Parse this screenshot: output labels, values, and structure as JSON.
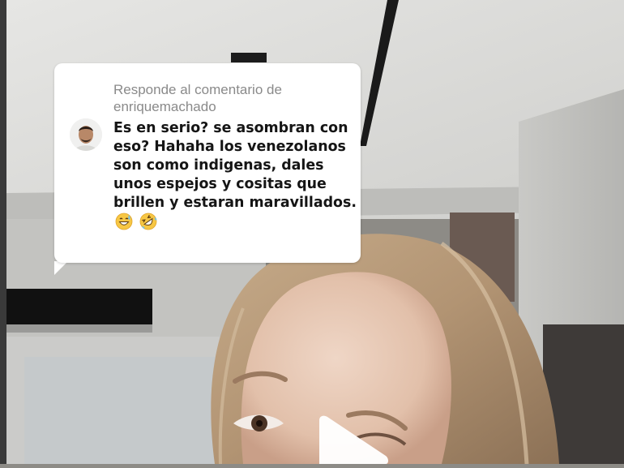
{
  "reply_card": {
    "header_line1": "Responde al comentario de",
    "header_line2": "enriquemachado",
    "comment": "Es en serio? se asombran con eso? Hahaha los venezolanos son como indigenas, dales unos espejos y cositas que brillen y estaran maravillados.",
    "emojis": [
      "grinning-sweat-emoji",
      "rofl-emoji"
    ]
  },
  "player": {
    "state": "paused",
    "icon": "play-icon"
  },
  "colors": {
    "card_bg": "#ffffff",
    "header_text": "#8a8a8a",
    "comment_text": "#151515"
  }
}
